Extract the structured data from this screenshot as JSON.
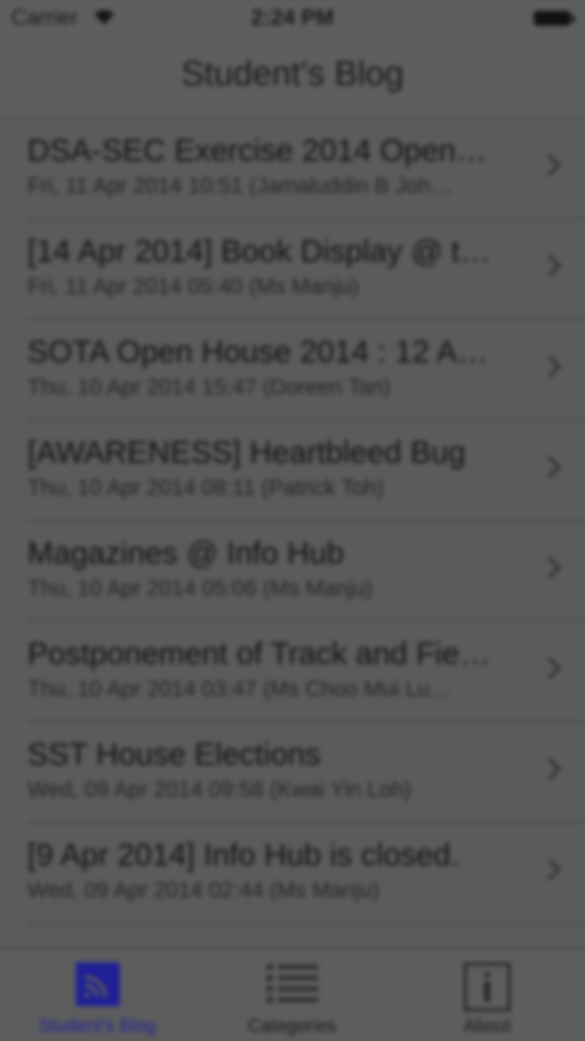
{
  "status_bar": {
    "carrier": "Carrier",
    "time": "2:24 PM",
    "wifi_icon": "wifi-icon",
    "battery_icon": "battery-icon"
  },
  "nav": {
    "title": "Student's Blog"
  },
  "posts": [
    {
      "title": "DSA-SEC Exercise 2014 Open…",
      "subtitle": "Fri, 11 Apr 2014 10:51 (Jamaluddin B Joh…"
    },
    {
      "title": "[14 Apr 2014] Book Display @ t…",
      "subtitle": "Fri, 11 Apr 2014 05:40 (Ms Manju)"
    },
    {
      "title": "SOTA Open House 2014 : 12 A…",
      "subtitle": "Thu, 10 Apr 2014 15:47 (Doreen Tan)"
    },
    {
      "title": "[AWARENESS] Heartbleed Bug",
      "subtitle": "Thu, 10 Apr 2014 08:11 (Patrick Toh)"
    },
    {
      "title": "Magazines @ Info Hub",
      "subtitle": "Thu, 10 Apr 2014 05:06 (Ms Manju)"
    },
    {
      "title": "Postponement of Track and Fie…",
      "subtitle": "Thu, 10 Apr 2014 03:47 (Ms Choo Mui Lu…"
    },
    {
      "title": "SST House Elections",
      "subtitle": "Wed, 09 Apr 2014 09:58 (Kwai Yin Loh)"
    },
    {
      "title": "[9 Apr 2014] Info Hub is closed.",
      "subtitle": "Wed, 09 Apr 2014 02:44 (Ms Manju)"
    }
  ],
  "tabs": [
    {
      "label": "Student's Blog",
      "icon": "rss-icon",
      "active": true
    },
    {
      "label": "Categories",
      "icon": "list-icon",
      "active": false
    },
    {
      "label": "About",
      "icon": "info-icon",
      "active": false
    }
  ],
  "colors": {
    "active_tab": "#1f1f96",
    "background": "#5b5b5b"
  }
}
